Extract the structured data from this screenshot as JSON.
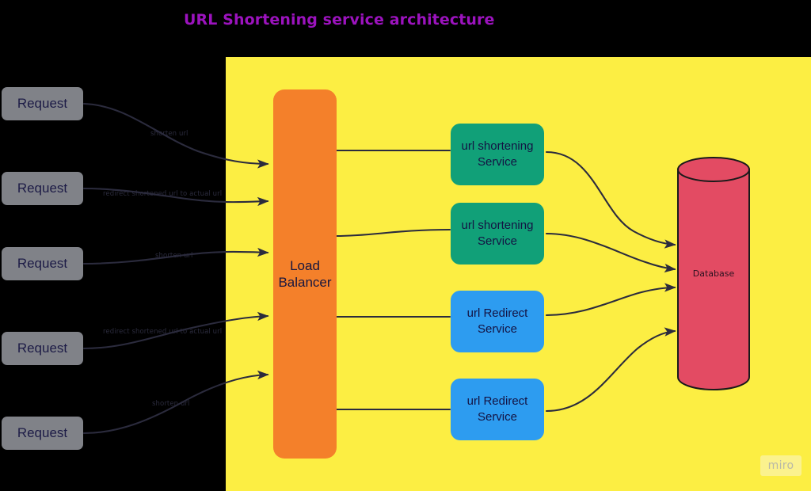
{
  "title": "URL Shortening service architecture",
  "colors": {
    "background": "#000000",
    "board": "#FCEE43",
    "title": "#9C13BE",
    "request": "#808288",
    "load_balancer": "#F4802A",
    "shortening_service": "#11A078",
    "redirect_service": "#2D9CF0",
    "database": "#E34B63",
    "edge": "#2B2B3D"
  },
  "requests": [
    {
      "label": "Request"
    },
    {
      "label": "Request"
    },
    {
      "label": "Request"
    },
    {
      "label": "Request"
    },
    {
      "label": "Request"
    }
  ],
  "edge_labels": [
    {
      "text": "shorten url"
    },
    {
      "text": "redirect shortened url to actual url"
    },
    {
      "text": "shorten url"
    },
    {
      "text": "redirect shortened url to actual url"
    },
    {
      "text": "shorten url"
    }
  ],
  "load_balancer": {
    "label": "Load\nBalancer",
    "line1": "Load",
    "line2": "Balancer"
  },
  "services": [
    {
      "line1": "url shortening",
      "line2": "Service",
      "kind": "shortening"
    },
    {
      "line1": "url shortening",
      "line2": "Service",
      "kind": "shortening"
    },
    {
      "line1": "url Redirect",
      "line2": "Service",
      "kind": "redirect"
    },
    {
      "line1": "url Redirect",
      "line2": "Service",
      "kind": "redirect"
    }
  ],
  "database": {
    "label": "Database"
  },
  "watermark": {
    "label": "miro"
  }
}
